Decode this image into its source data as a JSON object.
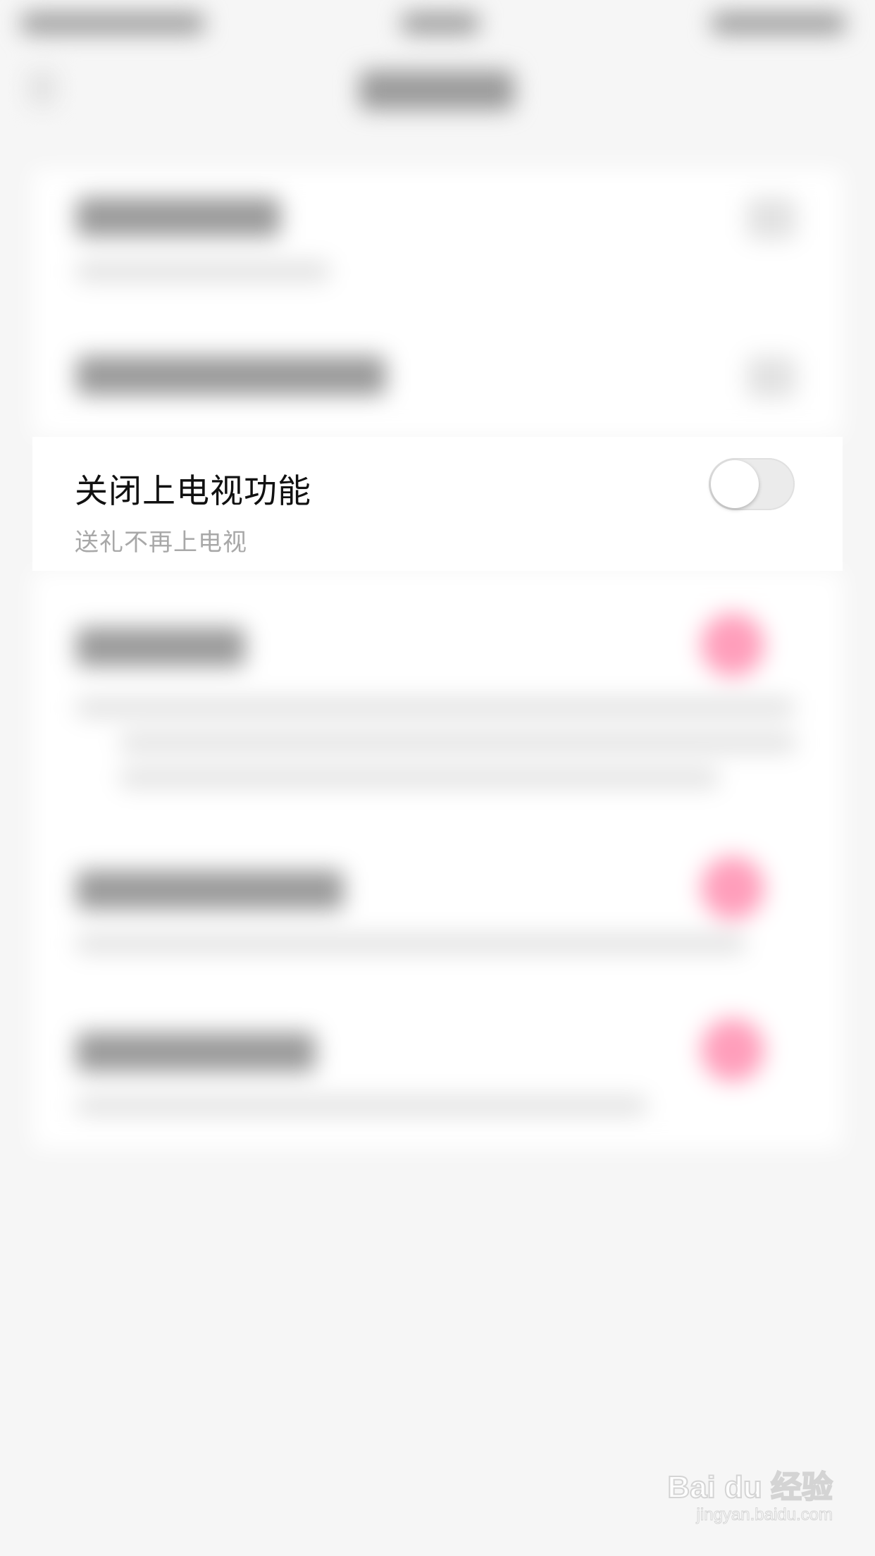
{
  "setting": {
    "title": "关闭上电视功能",
    "subtitle": "送礼不再上电视",
    "toggle_on": false
  },
  "watermark": {
    "main": "Bai du 经验",
    "sub": "jingyan.baidu.com"
  },
  "colors": {
    "page_bg": "#f6f6f6",
    "card_bg": "#ffffff",
    "title_text": "#111111",
    "subtitle_text": "#a8a8a8",
    "toggle_track_off": "#ebebeb",
    "accent_pink_blurred": "#ff9ebb"
  }
}
